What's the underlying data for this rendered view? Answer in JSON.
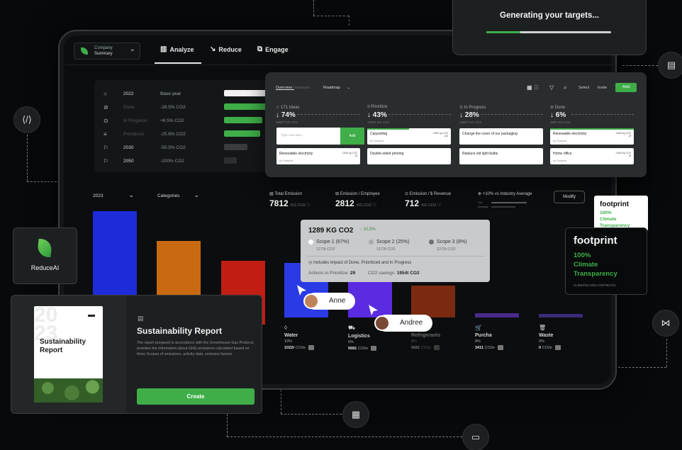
{
  "generating": {
    "text": "Generating your targets...",
    "progress": 0.27
  },
  "company": {
    "label": "Company",
    "value": "Summary"
  },
  "nav": {
    "analyze": "Analyze",
    "reduce": "Reduce",
    "engage": "Engage"
  },
  "years": [
    {
      "year": "2022",
      "label": "Base year",
      "value": "",
      "fill": 1.0,
      "color": "#f2f2f2"
    },
    {
      "year": "",
      "label": "Done",
      "value": "-28.5% CO2",
      "fill": 1.0,
      "color": "#3fae49"
    },
    {
      "year": "",
      "label": "In Progress",
      "value": "+6.5% CO2",
      "fill": 0.9,
      "color": "#3fae49"
    },
    {
      "year": "",
      "label": "Prioritized",
      "value": "-25.6% CO2",
      "fill": 0.85,
      "color": "#3fae49"
    },
    {
      "year": "2030",
      "label": "",
      "value": "-50.5% CO2",
      "fill": 0.55,
      "color": "#3a3d3e"
    },
    {
      "year": "2050",
      "label": "",
      "value": "-100% CO2",
      "fill": 0.3,
      "color": "#2c2f30"
    }
  ],
  "kanban": {
    "tabs": [
      "Overview",
      "Improved",
      "Roadmap"
    ],
    "select": "Select",
    "invite": "Invite",
    "add": "Add",
    "columns": [
      {
        "head": "171 Ideas",
        "pct": "↓ 74%",
        "sub": "1885T KG CO2"
      },
      {
        "head": "Prioritize",
        "pct": "↓ 43%",
        "sub": "1785T KG CO2"
      },
      {
        "head": "In Progress",
        "pct": "↓ 28%",
        "sub": "1685T KG CO2"
      },
      {
        "head": "Done",
        "pct": "↓ 6%",
        "sub": "186T KG CO2"
      }
    ],
    "input_placeholder": "Type new idea...",
    "input_add": "Add",
    "cards": [
      {
        "title": "Renewable electricity",
        "meta": "-1846 kg CO2\n-5t",
        "tag": "by Footprint"
      },
      {
        "title": "Carpooling",
        "meta": "-1889 kg CO2\n-44t",
        "tag": "by Footprint"
      },
      {
        "title": "Double-sided printing",
        "meta": "",
        "tag": ""
      },
      {
        "title": "Change the cover of our packaging",
        "meta": "",
        "tag": ""
      },
      {
        "title": "Replace old light bulbs",
        "meta": "",
        "tag": ""
      },
      {
        "title": "Renewable electricity",
        "meta": "-1846 kg CO2\n-5t",
        "tag": "by Footprint"
      },
      {
        "title": "Home office",
        "meta": "-1845 kg CO2\n-5t",
        "tag": "by Footprint"
      }
    ]
  },
  "filters": {
    "year": "2023",
    "categories": "Categories"
  },
  "stats": [
    {
      "label": "Total Emission",
      "value": "7812",
      "unit": "KG CO2"
    },
    {
      "label": "Emission / Employee",
      "value": "2812",
      "unit": "KG CO2"
    },
    {
      "label": "Emission / $ Revenue",
      "value": "712",
      "unit": "KG CO2"
    }
  ],
  "industry": {
    "label": "+10% vs Industry Average",
    "you": "You",
    "average": "Average"
  },
  "modify": "Modify",
  "scope": {
    "title": "1289 KG CO2",
    "delta": "↓ 10,5%",
    "items": [
      {
        "name": "Scope 1 (67%)",
        "value": "1273t CO2",
        "color": "#ffffff"
      },
      {
        "name": "Scope 2 (25%)",
        "value": "1273t CO2",
        "color": "#a9aaab"
      },
      {
        "name": "Scope 3 (8%)",
        "value": "1273t CO2",
        "color": "#6f7071"
      }
    ],
    "note": "Includes impact of Done, Prioritized and In Progress",
    "actions_label": "Actions in Prioritize:",
    "actions_value": "29",
    "savings_label": "CO2 savings:",
    "savings_value": "1954t CO2"
  },
  "bars": [
    {
      "color": "#1d2bd9",
      "value": 100
    },
    {
      "color": "#c96a12",
      "value": 74
    },
    {
      "color": "#c01e12",
      "value": 56
    },
    {
      "color": "#2a3be6",
      "value": 48
    },
    {
      "color": "#5a2be0",
      "value": 33
    },
    {
      "color": "#7a2a10",
      "value": 28
    },
    {
      "color": "#4a2a8a",
      "value": 4
    },
    {
      "color": "#3a2a7a",
      "value": 3
    }
  ],
  "categories": [
    {
      "name": "Water",
      "pct": "10%",
      "kg": "1022t",
      "unit": "CO2e"
    },
    {
      "name": "Logistics",
      "pct": "5%",
      "kg": "5681",
      "unit": "CO2e"
    },
    {
      "name": "Refrigerants",
      "pct": "8%",
      "kg": "5681",
      "unit": "CO2e"
    },
    {
      "name": "Purcha",
      "pct": "8%",
      "kg": "3411",
      "unit": "CO2e"
    },
    {
      "name": "Waste",
      "pct": "0%",
      "kg": "0",
      "unit": "CO2e"
    }
  ],
  "users": {
    "anne": "Anne",
    "andree": "Andree"
  },
  "report": {
    "book_bg": "20\n23",
    "book_title": "Sustainability\nReport",
    "heading": "Sustainability Report",
    "body": "The report prepared in accordance with the Greenhouse Gas Protocol, provides the information about GHG emissions calculated based on three Scopes of emissions, activity data, emission factors.",
    "create": "Create"
  },
  "reduceai": {
    "label": "ReduceAI"
  },
  "footprint": {
    "title": "footprint",
    "lines": [
      "100%",
      "Climate",
      "Transparency"
    ],
    "foot": "CLIMATECARD.CO/FP81721"
  },
  "colors": {
    "accent": "#3fae49",
    "background": "#07090a",
    "panel": "#1d2021"
  }
}
